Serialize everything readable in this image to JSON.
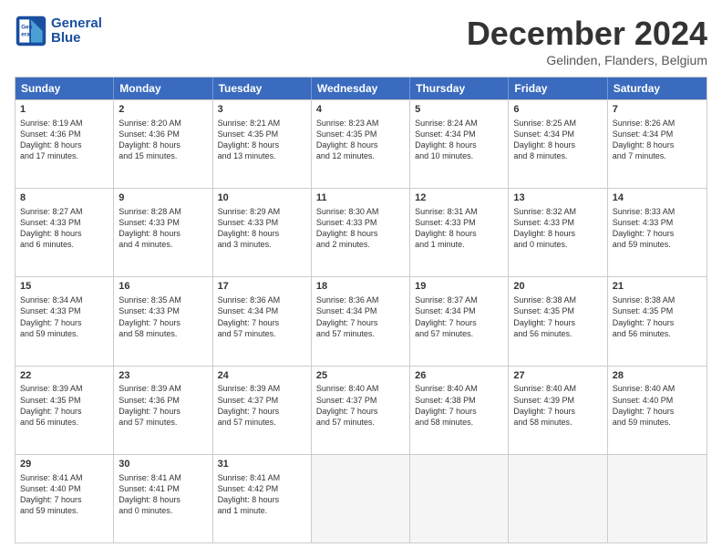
{
  "header": {
    "logo_line1": "General",
    "logo_line2": "Blue",
    "month": "December 2024",
    "location": "Gelinden, Flanders, Belgium"
  },
  "days": [
    "Sunday",
    "Monday",
    "Tuesday",
    "Wednesday",
    "Thursday",
    "Friday",
    "Saturday"
  ],
  "weeks": [
    [
      {
        "day": "1",
        "lines": [
          "Sunrise: 8:19 AM",
          "Sunset: 4:36 PM",
          "Daylight: 8 hours",
          "and 17 minutes."
        ]
      },
      {
        "day": "2",
        "lines": [
          "Sunrise: 8:20 AM",
          "Sunset: 4:36 PM",
          "Daylight: 8 hours",
          "and 15 minutes."
        ]
      },
      {
        "day": "3",
        "lines": [
          "Sunrise: 8:21 AM",
          "Sunset: 4:35 PM",
          "Daylight: 8 hours",
          "and 13 minutes."
        ]
      },
      {
        "day": "4",
        "lines": [
          "Sunrise: 8:23 AM",
          "Sunset: 4:35 PM",
          "Daylight: 8 hours",
          "and 12 minutes."
        ]
      },
      {
        "day": "5",
        "lines": [
          "Sunrise: 8:24 AM",
          "Sunset: 4:34 PM",
          "Daylight: 8 hours",
          "and 10 minutes."
        ]
      },
      {
        "day": "6",
        "lines": [
          "Sunrise: 8:25 AM",
          "Sunset: 4:34 PM",
          "Daylight: 8 hours",
          "and 8 minutes."
        ]
      },
      {
        "day": "7",
        "lines": [
          "Sunrise: 8:26 AM",
          "Sunset: 4:34 PM",
          "Daylight: 8 hours",
          "and 7 minutes."
        ]
      }
    ],
    [
      {
        "day": "8",
        "lines": [
          "Sunrise: 8:27 AM",
          "Sunset: 4:33 PM",
          "Daylight: 8 hours",
          "and 6 minutes."
        ]
      },
      {
        "day": "9",
        "lines": [
          "Sunrise: 8:28 AM",
          "Sunset: 4:33 PM",
          "Daylight: 8 hours",
          "and 4 minutes."
        ]
      },
      {
        "day": "10",
        "lines": [
          "Sunrise: 8:29 AM",
          "Sunset: 4:33 PM",
          "Daylight: 8 hours",
          "and 3 minutes."
        ]
      },
      {
        "day": "11",
        "lines": [
          "Sunrise: 8:30 AM",
          "Sunset: 4:33 PM",
          "Daylight: 8 hours",
          "and 2 minutes."
        ]
      },
      {
        "day": "12",
        "lines": [
          "Sunrise: 8:31 AM",
          "Sunset: 4:33 PM",
          "Daylight: 8 hours",
          "and 1 minute."
        ]
      },
      {
        "day": "13",
        "lines": [
          "Sunrise: 8:32 AM",
          "Sunset: 4:33 PM",
          "Daylight: 8 hours",
          "and 0 minutes."
        ]
      },
      {
        "day": "14",
        "lines": [
          "Sunrise: 8:33 AM",
          "Sunset: 4:33 PM",
          "Daylight: 7 hours",
          "and 59 minutes."
        ]
      }
    ],
    [
      {
        "day": "15",
        "lines": [
          "Sunrise: 8:34 AM",
          "Sunset: 4:33 PM",
          "Daylight: 7 hours",
          "and 59 minutes."
        ]
      },
      {
        "day": "16",
        "lines": [
          "Sunrise: 8:35 AM",
          "Sunset: 4:33 PM",
          "Daylight: 7 hours",
          "and 58 minutes."
        ]
      },
      {
        "day": "17",
        "lines": [
          "Sunrise: 8:36 AM",
          "Sunset: 4:34 PM",
          "Daylight: 7 hours",
          "and 57 minutes."
        ]
      },
      {
        "day": "18",
        "lines": [
          "Sunrise: 8:36 AM",
          "Sunset: 4:34 PM",
          "Daylight: 7 hours",
          "and 57 minutes."
        ]
      },
      {
        "day": "19",
        "lines": [
          "Sunrise: 8:37 AM",
          "Sunset: 4:34 PM",
          "Daylight: 7 hours",
          "and 57 minutes."
        ]
      },
      {
        "day": "20",
        "lines": [
          "Sunrise: 8:38 AM",
          "Sunset: 4:35 PM",
          "Daylight: 7 hours",
          "and 56 minutes."
        ]
      },
      {
        "day": "21",
        "lines": [
          "Sunrise: 8:38 AM",
          "Sunset: 4:35 PM",
          "Daylight: 7 hours",
          "and 56 minutes."
        ]
      }
    ],
    [
      {
        "day": "22",
        "lines": [
          "Sunrise: 8:39 AM",
          "Sunset: 4:35 PM",
          "Daylight: 7 hours",
          "and 56 minutes."
        ]
      },
      {
        "day": "23",
        "lines": [
          "Sunrise: 8:39 AM",
          "Sunset: 4:36 PM",
          "Daylight: 7 hours",
          "and 57 minutes."
        ]
      },
      {
        "day": "24",
        "lines": [
          "Sunrise: 8:39 AM",
          "Sunset: 4:37 PM",
          "Daylight: 7 hours",
          "and 57 minutes."
        ]
      },
      {
        "day": "25",
        "lines": [
          "Sunrise: 8:40 AM",
          "Sunset: 4:37 PM",
          "Daylight: 7 hours",
          "and 57 minutes."
        ]
      },
      {
        "day": "26",
        "lines": [
          "Sunrise: 8:40 AM",
          "Sunset: 4:38 PM",
          "Daylight: 7 hours",
          "and 58 minutes."
        ]
      },
      {
        "day": "27",
        "lines": [
          "Sunrise: 8:40 AM",
          "Sunset: 4:39 PM",
          "Daylight: 7 hours",
          "and 58 minutes."
        ]
      },
      {
        "day": "28",
        "lines": [
          "Sunrise: 8:40 AM",
          "Sunset: 4:40 PM",
          "Daylight: 7 hours",
          "and 59 minutes."
        ]
      }
    ],
    [
      {
        "day": "29",
        "lines": [
          "Sunrise: 8:41 AM",
          "Sunset: 4:40 PM",
          "Daylight: 7 hours",
          "and 59 minutes."
        ]
      },
      {
        "day": "30",
        "lines": [
          "Sunrise: 8:41 AM",
          "Sunset: 4:41 PM",
          "Daylight: 8 hours",
          "and 0 minutes."
        ]
      },
      {
        "day": "31",
        "lines": [
          "Sunrise: 8:41 AM",
          "Sunset: 4:42 PM",
          "Daylight: 8 hours",
          "and 1 minute."
        ]
      },
      null,
      null,
      null,
      null
    ]
  ]
}
